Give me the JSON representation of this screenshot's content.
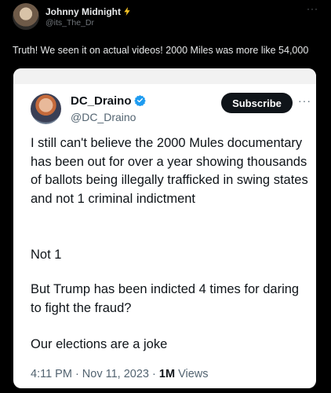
{
  "outer_post": {
    "author_name": "Johnny Midnight",
    "author_handle": "@its_The_Dr",
    "more_label": "···",
    "text": "Truth! We seen it on actual videos! 2000 Miles was more like 54,000"
  },
  "embedded_post": {
    "author_name": "DC_Draino",
    "author_handle": "@DC_Draino",
    "subscribe_label": "Subscribe",
    "more_label": "···",
    "paragraphs": [
      "I still can't believe the 2000 Mules documentary has been out for over a year showing thousands of ballots being illegally trafficked in swing states and not 1 criminal indictment",
      "Not 1",
      "But Trump has been indicted 4 times for daring to fight the fraud?",
      "Our elections are a joke"
    ],
    "timestamp": "4:11 PM · Nov 11, 2023 · ",
    "views_count": "1M",
    "views_label": " Views"
  },
  "colors": {
    "background": "#000000",
    "verified_blue": "#1d9bf0",
    "subscribe_bg": "#0f1419",
    "lightning": "#f7c325"
  },
  "icons": {
    "author_badge": "lightning-icon",
    "verified": "verified-badge-icon"
  }
}
